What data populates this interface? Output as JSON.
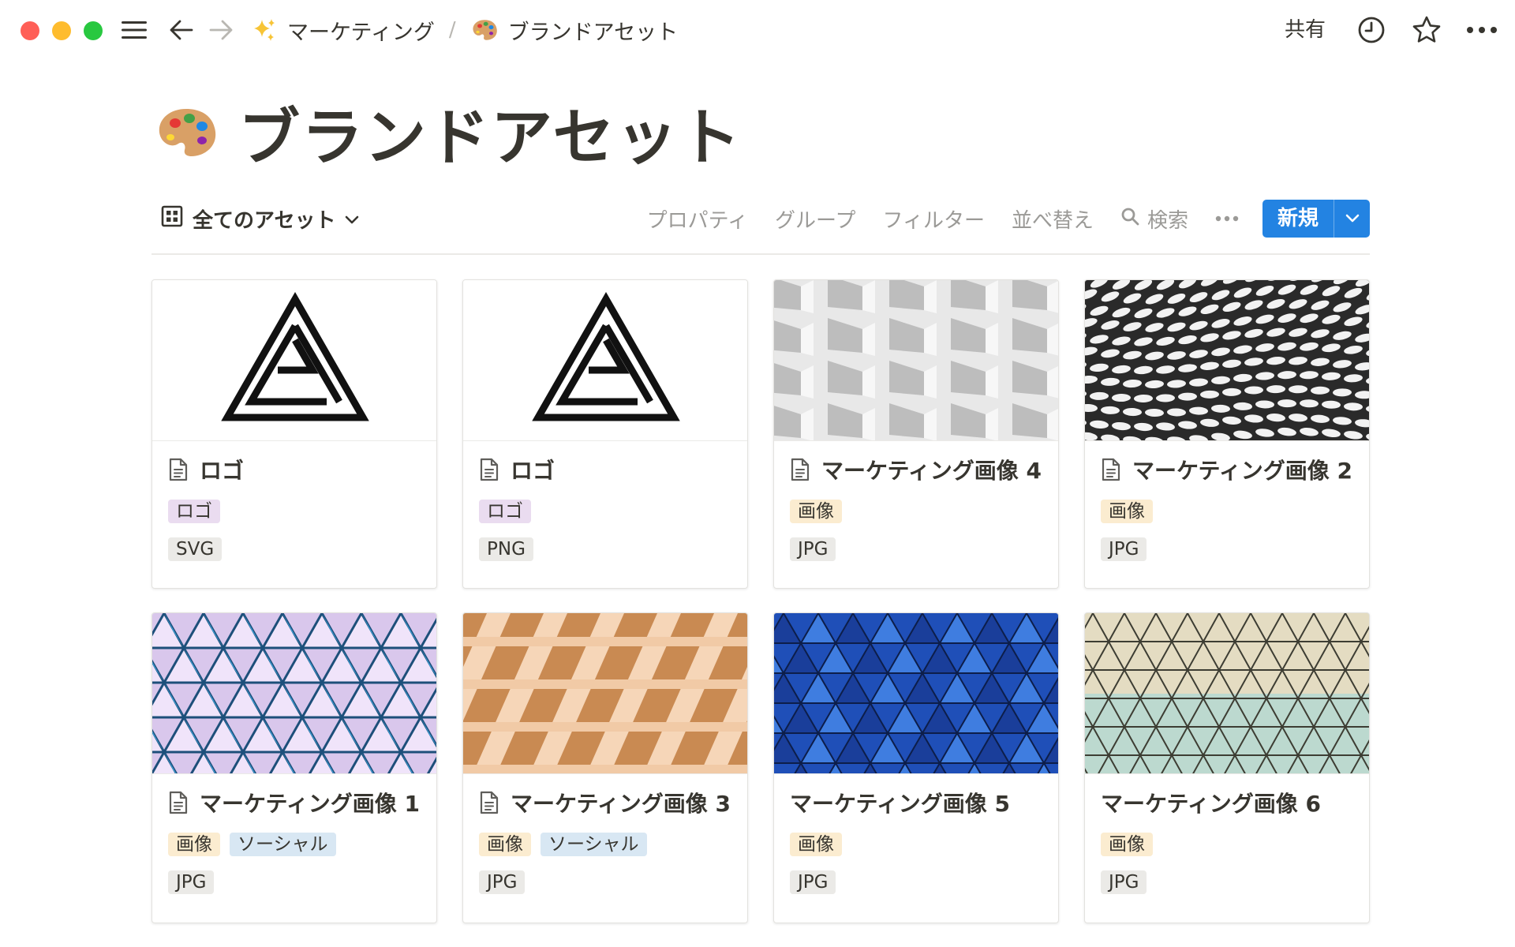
{
  "colors": {
    "accent": "#2383e2",
    "tag_logo": "#eadcf0",
    "tag_image": "#fbecd0",
    "tag_social": "#d8e7f3",
    "tag_format": "#ebeae7"
  },
  "topbar": {
    "breadcrumbs": [
      {
        "emoji": "sparkles",
        "label": "マーケティング"
      },
      {
        "emoji": "palette",
        "label": "ブランドアセット"
      }
    ],
    "separator": "/",
    "share_label": "共有"
  },
  "page": {
    "emoji": "palette",
    "title": "ブランドアセット"
  },
  "view": {
    "label": "全てのアセット",
    "actions": {
      "properties": "プロパティ",
      "group": "グループ",
      "filter": "フィルター",
      "sort": "並べ替え",
      "search": "検索"
    },
    "new_label": "新規"
  },
  "cards": [
    {
      "title": "ロゴ",
      "has_doc_icon": true,
      "cover": "logo",
      "tags": [
        {
          "label": "ロゴ",
          "kind": "logo"
        }
      ],
      "format": "SVG"
    },
    {
      "title": "ロゴ",
      "has_doc_icon": true,
      "cover": "logo",
      "tags": [
        {
          "label": "ロゴ",
          "kind": "logo"
        }
      ],
      "format": "PNG"
    },
    {
      "title": "マーケティング画像 4",
      "has_doc_icon": true,
      "cover": "white-building",
      "tags": [
        {
          "label": "画像",
          "kind": "image"
        }
      ],
      "format": "JPG"
    },
    {
      "title": "マーケティング画像 2",
      "has_doc_icon": true,
      "cover": "bw-wave",
      "tags": [
        {
          "label": "画像",
          "kind": "image"
        }
      ],
      "format": "JPG"
    },
    {
      "title": "マーケティング画像 1",
      "has_doc_icon": true,
      "cover": "purple-triangles",
      "tags": [
        {
          "label": "画像",
          "kind": "image"
        },
        {
          "label": "ソーシャル",
          "kind": "social"
        }
      ],
      "format": "JPG"
    },
    {
      "title": "マーケティング画像 3",
      "has_doc_icon": true,
      "cover": "orange-building",
      "tags": [
        {
          "label": "画像",
          "kind": "image"
        },
        {
          "label": "ソーシャル",
          "kind": "social"
        }
      ],
      "format": "JPG"
    },
    {
      "title": "マーケティング画像 5",
      "has_doc_icon": false,
      "cover": "blue-glass",
      "tags": [
        {
          "label": "画像",
          "kind": "image"
        }
      ],
      "format": "JPG"
    },
    {
      "title": "マーケティング画像 6",
      "has_doc_icon": false,
      "cover": "green-dome",
      "tags": [
        {
          "label": "画像",
          "kind": "image"
        }
      ],
      "format": "JPG"
    }
  ]
}
